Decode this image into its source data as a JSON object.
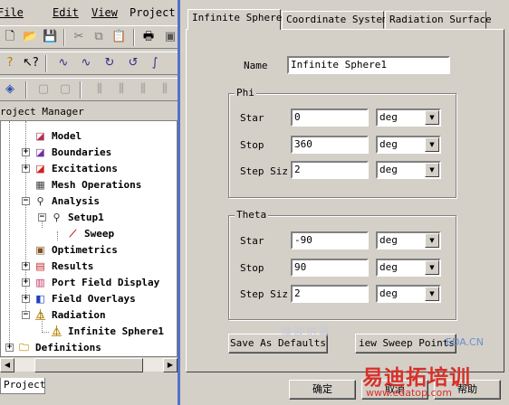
{
  "menu": {
    "items": [
      "File",
      "Edit",
      "View",
      "Project"
    ]
  },
  "toolbar": {
    "row1_icons": [
      "new-icon",
      "open-icon",
      "save-icon",
      "cut-icon",
      "copy-icon",
      "paste-icon",
      "print-icon"
    ],
    "row2_icons": [
      "help-icon",
      "context-help-icon",
      "draw-line-icon",
      "draw-spline-icon",
      "draw-arc-icon",
      "draw-center-arc-icon",
      "draw-equation-icon"
    ],
    "row3_icons": [
      "model-icon",
      "box-icon",
      "box-icon",
      "align-icon",
      "align-icon",
      "align-icon",
      "align-icon"
    ]
  },
  "project_manager": {
    "title": "roject Manager",
    "tab_label": "Project",
    "tree": [
      {
        "label": "Model",
        "level": 1,
        "expander": ""
      },
      {
        "label": "Boundaries",
        "level": 1,
        "expander": "+"
      },
      {
        "label": "Excitations",
        "level": 1,
        "expander": "+"
      },
      {
        "label": "Mesh Operations",
        "level": 1,
        "expander": ""
      },
      {
        "label": "Analysis",
        "level": 1,
        "expander": "−"
      },
      {
        "label": "Setup1",
        "level": 2,
        "expander": "−"
      },
      {
        "label": "Sweep",
        "level": 3,
        "expander": ""
      },
      {
        "label": "Optimetrics",
        "level": 1,
        "expander": ""
      },
      {
        "label": "Results",
        "level": 1,
        "expander": "+"
      },
      {
        "label": "Port Field Display",
        "level": 1,
        "expander": "+"
      },
      {
        "label": "Field Overlays",
        "level": 1,
        "expander": "+"
      },
      {
        "label": "Radiation",
        "level": 1,
        "expander": "−"
      },
      {
        "label": "Infinite Sphere1",
        "level": 2,
        "expander": "",
        "selected": true
      },
      {
        "label": "Definitions",
        "level": 0,
        "expander": "+"
      }
    ]
  },
  "dialog": {
    "tabs": [
      "Infinite Sphere",
      "Coordinate System",
      "Radiation Surface"
    ],
    "active_tab": "Infinite Sphere",
    "name_label": "Name",
    "name_value": "Infinite Sphere1",
    "phi": {
      "title": "Phi",
      "start_label": "Star",
      "start_value": "0",
      "start_unit": "deg",
      "stop_label": "Stop",
      "stop_value": "360",
      "stop_unit": "deg",
      "step_label": "Step Siz",
      "step_value": "2",
      "step_unit": "deg"
    },
    "theta": {
      "title": "Theta",
      "start_label": "Star",
      "start_value": "-90",
      "start_unit": "deg",
      "stop_label": "Stop",
      "stop_value": "90",
      "stop_unit": "deg",
      "step_label": "Step Siz",
      "step_value": "2",
      "step_unit": "deg"
    },
    "save_defaults_label": "Save As Defaults",
    "view_sweep_label": "iew Sweep Points",
    "ok_label": "确定",
    "cancel_label": "取消",
    "help_label": "帮助"
  },
  "watermark": {
    "top_text": "EDA.CN",
    "brand_text": "易迪拓培训",
    "url_text": "www.edatop.com",
    "faint_text": "微波仿真"
  },
  "colors": {
    "dialog_border": "#5670c8",
    "watermark_red": "#d8302a",
    "watermark_blue": "#6d8fd0"
  }
}
